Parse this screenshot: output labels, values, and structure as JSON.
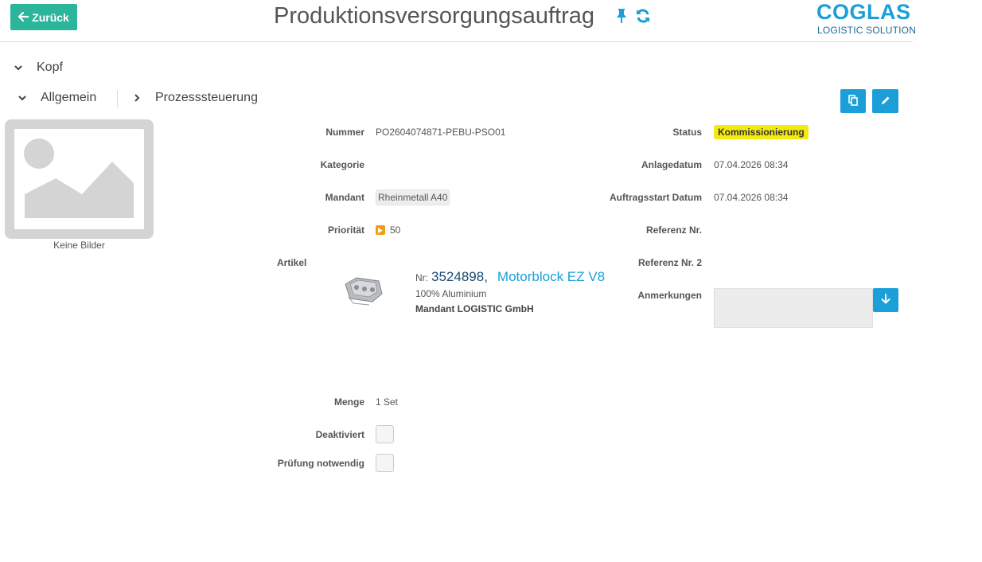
{
  "header": {
    "back_label": "Zurück",
    "title": "Produktionsversorgungsauftrag",
    "logo_main": "COGLAS",
    "logo_sub": "LOGISTIC SOLUTION"
  },
  "sections": {
    "kopf": "Kopf",
    "allgemein": "Allgemein",
    "prozesssteuerung": "Prozesssteuerung"
  },
  "image_placeholder": {
    "caption": "Keine Bilder"
  },
  "fields_left": {
    "nummer_label": "Nummer",
    "nummer_value": "PO2604074871-PEBU-PSO01",
    "kategorie_label": "Kategorie",
    "mandant_label": "Mandant",
    "mandant_value": "Rheinmetall A40",
    "prioritaet_label": "Priorität",
    "prioritaet_value": "50",
    "artikel_label": "Artikel",
    "menge_label": "Menge",
    "menge_value": "1 Set",
    "deaktiviert_label": "Deaktiviert",
    "pruefung_label": "Prüfung notwendig"
  },
  "article": {
    "nr_label": "Nr:",
    "nr": "3524898",
    "name": "Motorblock EZ V8",
    "material": "100% Aluminium",
    "mandant": "Mandant LOGISTIC GmbH"
  },
  "fields_right": {
    "status_label": "Status",
    "status_value": "Kommissionierung",
    "anlagedatum_label": "Anlagedatum",
    "anlagedatum_value": "07.04.2026 08:34",
    "auftragsstart_label": "Auftragsstart Datum",
    "auftragsstart_value": "07.04.2026 08:34",
    "referenz_label": "Referenz Nr.",
    "referenz2_label": "Referenz Nr. 2",
    "anmerkungen_label": "Anmerkungen"
  },
  "colors": {
    "primary": "#1a9fd8",
    "back_button": "#2bb59a",
    "status_badge": "#f3ea0f",
    "priority": "#f39c12"
  },
  "icons": {
    "back": "arrow-left-icon",
    "pin": "pin-icon",
    "refresh": "refresh-icon",
    "copy": "copy-icon",
    "edit": "pencil-icon",
    "download": "arrow-down-icon"
  }
}
